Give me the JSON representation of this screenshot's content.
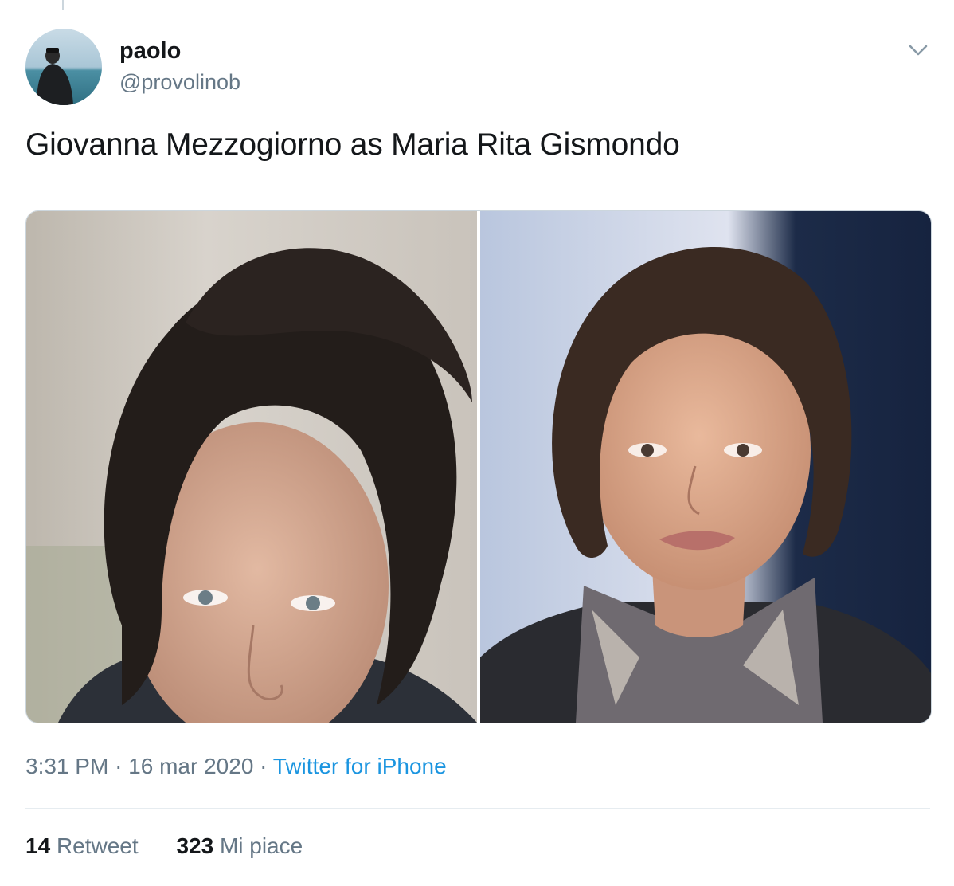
{
  "tweet": {
    "author": {
      "name": "paolo",
      "handle": "@provolinob"
    },
    "text": "Giovanna Mezzogiorno as Maria Rita Gismondo",
    "timestamp": {
      "time": "3:31 PM",
      "date": "16 mar 2020",
      "separator": "·",
      "source": "Twitter for iPhone"
    },
    "stats": {
      "retweets": "14",
      "retweets_label": "Retweet",
      "likes": "323",
      "likes_label": "Mi piace"
    }
  },
  "colors": {
    "link": "#1b95e0",
    "secondary_text": "#657786",
    "primary_text": "#14171a",
    "border": "#e6ecf0"
  },
  "icons": {
    "menu": "chevron-down-icon"
  }
}
